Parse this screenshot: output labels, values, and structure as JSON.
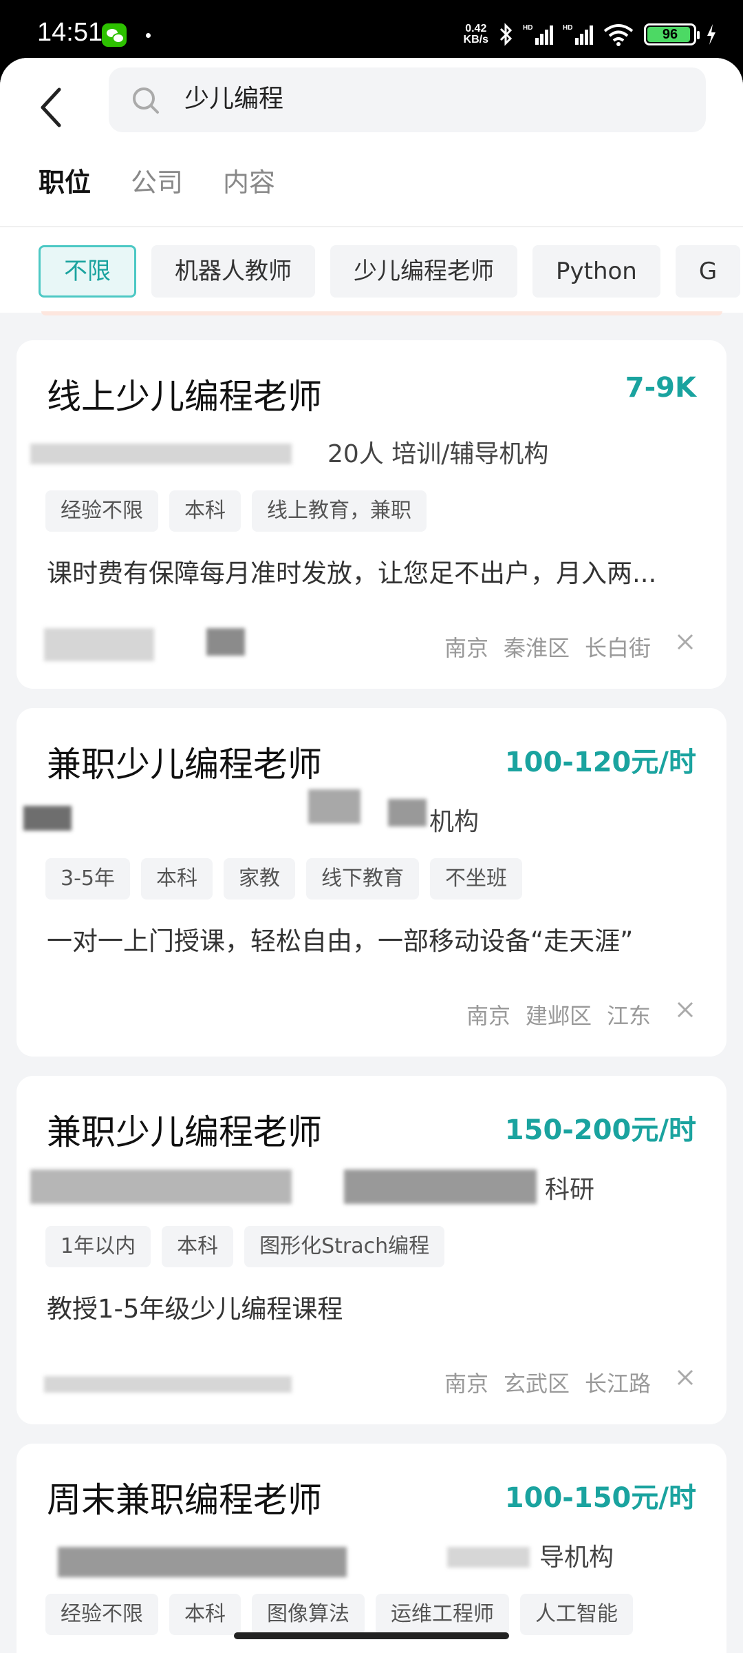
{
  "status": {
    "time": "14:51",
    "speed_value": "0.42",
    "speed_unit": "KB/s",
    "battery": "96"
  },
  "search": {
    "query": "少儿编程"
  },
  "tabs": [
    "职位",
    "公司",
    "内容"
  ],
  "chips": [
    "不限",
    "机器人教师",
    "少儿编程老师",
    "Python",
    "G"
  ],
  "jobs": [
    {
      "title": "线上少儿编程老师",
      "salary": "7-9K",
      "company": "20人  培训/辅导机构",
      "tags": [
        "经验不限",
        "本科",
        "线上教育，兼职"
      ],
      "desc": "课时费有保障每月准时发放，让您足不出户，月入两...",
      "loc": [
        "南京",
        "秦淮区",
        "长白街"
      ]
    },
    {
      "title": "兼职少儿编程老师",
      "salary": "100-120元/时",
      "company": "机构",
      "tags": [
        "3-5年",
        "本科",
        "家教",
        "线下教育",
        "不坐班"
      ],
      "desc": "一对一上门授课，轻松自由，一部移动设备“走天涯”",
      "loc": [
        "南京",
        "建邺区",
        "江东"
      ]
    },
    {
      "title": "兼职少儿编程老师",
      "salary": "150-200元/时",
      "company": "科研",
      "tags": [
        "1年以内",
        "本科",
        "图形化Strach编程"
      ],
      "desc": "教授1-5年级少儿编程课程",
      "loc": [
        "南京",
        "玄武区",
        "长江路"
      ]
    },
    {
      "title": "周末兼职编程老师",
      "salary": "100-150元/时",
      "company": "导机构",
      "tags": [
        "经验不限",
        "本科",
        "图像算法",
        "运维工程师",
        "人工智能"
      ],
      "desc": "",
      "loc": []
    }
  ]
}
